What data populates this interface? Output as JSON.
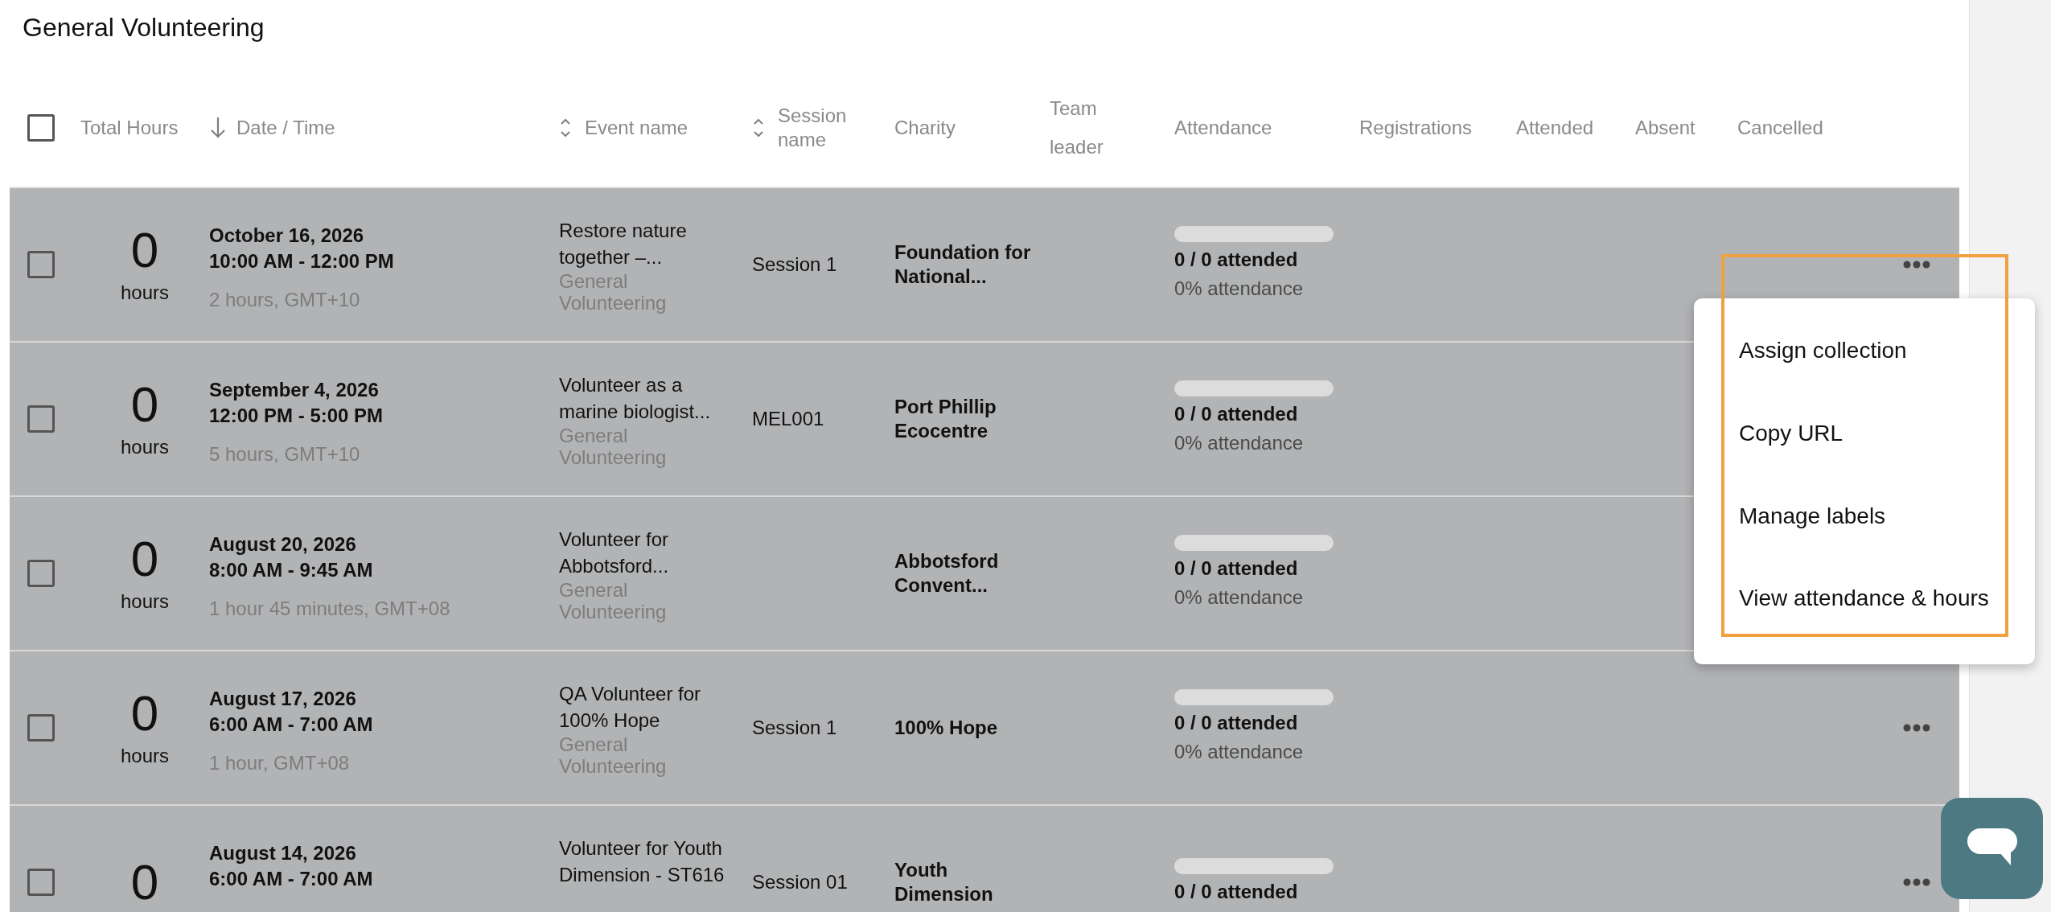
{
  "title": "General Volunteering",
  "table": {
    "select_all_checked": false,
    "columns": [
      {
        "label": "Total Hours",
        "kind": "plain"
      },
      {
        "label": "Date / Time",
        "kind": "sorted"
      },
      {
        "label": "Event name",
        "kind": "sortable"
      },
      {
        "label": "Session name",
        "kind": "sortable"
      },
      {
        "label": "Charity",
        "kind": "plain"
      },
      {
        "label": "Team leader",
        "kind": "plain"
      },
      {
        "label": "Attendance",
        "kind": "plain"
      },
      {
        "label": "Registrations",
        "kind": "plain"
      },
      {
        "label": "Attended",
        "kind": "plain"
      },
      {
        "label": "Absent",
        "kind": "plain"
      },
      {
        "label": "Cancelled",
        "kind": "plain"
      }
    ],
    "rows": [
      {
        "checked": false,
        "hours": "0",
        "hours_unit": "hours",
        "date": "October 16, 2026",
        "time": "10:00 AM - 12:00 PM",
        "duration": "2 hours, GMT+10",
        "event": "Restore nature together –...",
        "category": "General Volunteering",
        "session": "Session 1",
        "charity": "Foundation for National...",
        "attended": "0 / 0 attended",
        "attendance": "0% attendance",
        "level": 0
      },
      {
        "checked": false,
        "hours": "0",
        "hours_unit": "hours",
        "date": "September 4, 2026",
        "time": "12:00 PM - 5:00 PM",
        "duration": "5 hours, GMT+10",
        "event": "Volunteer as a marine biologist...",
        "category": "General Volunteering",
        "session": "MEL001",
        "charity": "Port Phillip Ecocentre",
        "attended": "0 / 0 attended",
        "attendance": "0% attendance",
        "level": 0
      },
      {
        "checked": false,
        "hours": "0",
        "hours_unit": "hours",
        "date": "August 20, 2026",
        "time": "8:00 AM - 9:45 AM",
        "duration": "1 hour 45 minutes, GMT+08",
        "event": "Volunteer for Abbotsford...",
        "category": "General Volunteering",
        "charity": "Abbotsford Convent...",
        "attended": "0 / 0 attended",
        "attendance": "0% attendance",
        "level": 0
      },
      {
        "checked": false,
        "hours": "0",
        "hours_unit": "hours",
        "date": "August 17, 2026",
        "time": "6:00 AM - 7:00 AM",
        "duration": "1 hour, GMT+08",
        "event": "QA Volunteer for 100% Hope",
        "category": "General Volunteering",
        "session": "Session 1",
        "charity": "100% Hope",
        "attended": "0 / 0 attended",
        "attendance": "0% attendance",
        "level": 0
      },
      {
        "checked": false,
        "hours": "0",
        "date": "August 14, 2026",
        "time": "6:00 AM - 7:00 AM",
        "event": "Volunteer for Youth Dimension - ST616",
        "session": "Session 01",
        "charity": "Youth Dimension",
        "attended": "0 / 0 attended",
        "level": 0
      }
    ]
  },
  "context_menu": {
    "items": [
      "Assign collection",
      "Copy URL",
      "Manage labels",
      "View attendance & hours"
    ]
  }
}
